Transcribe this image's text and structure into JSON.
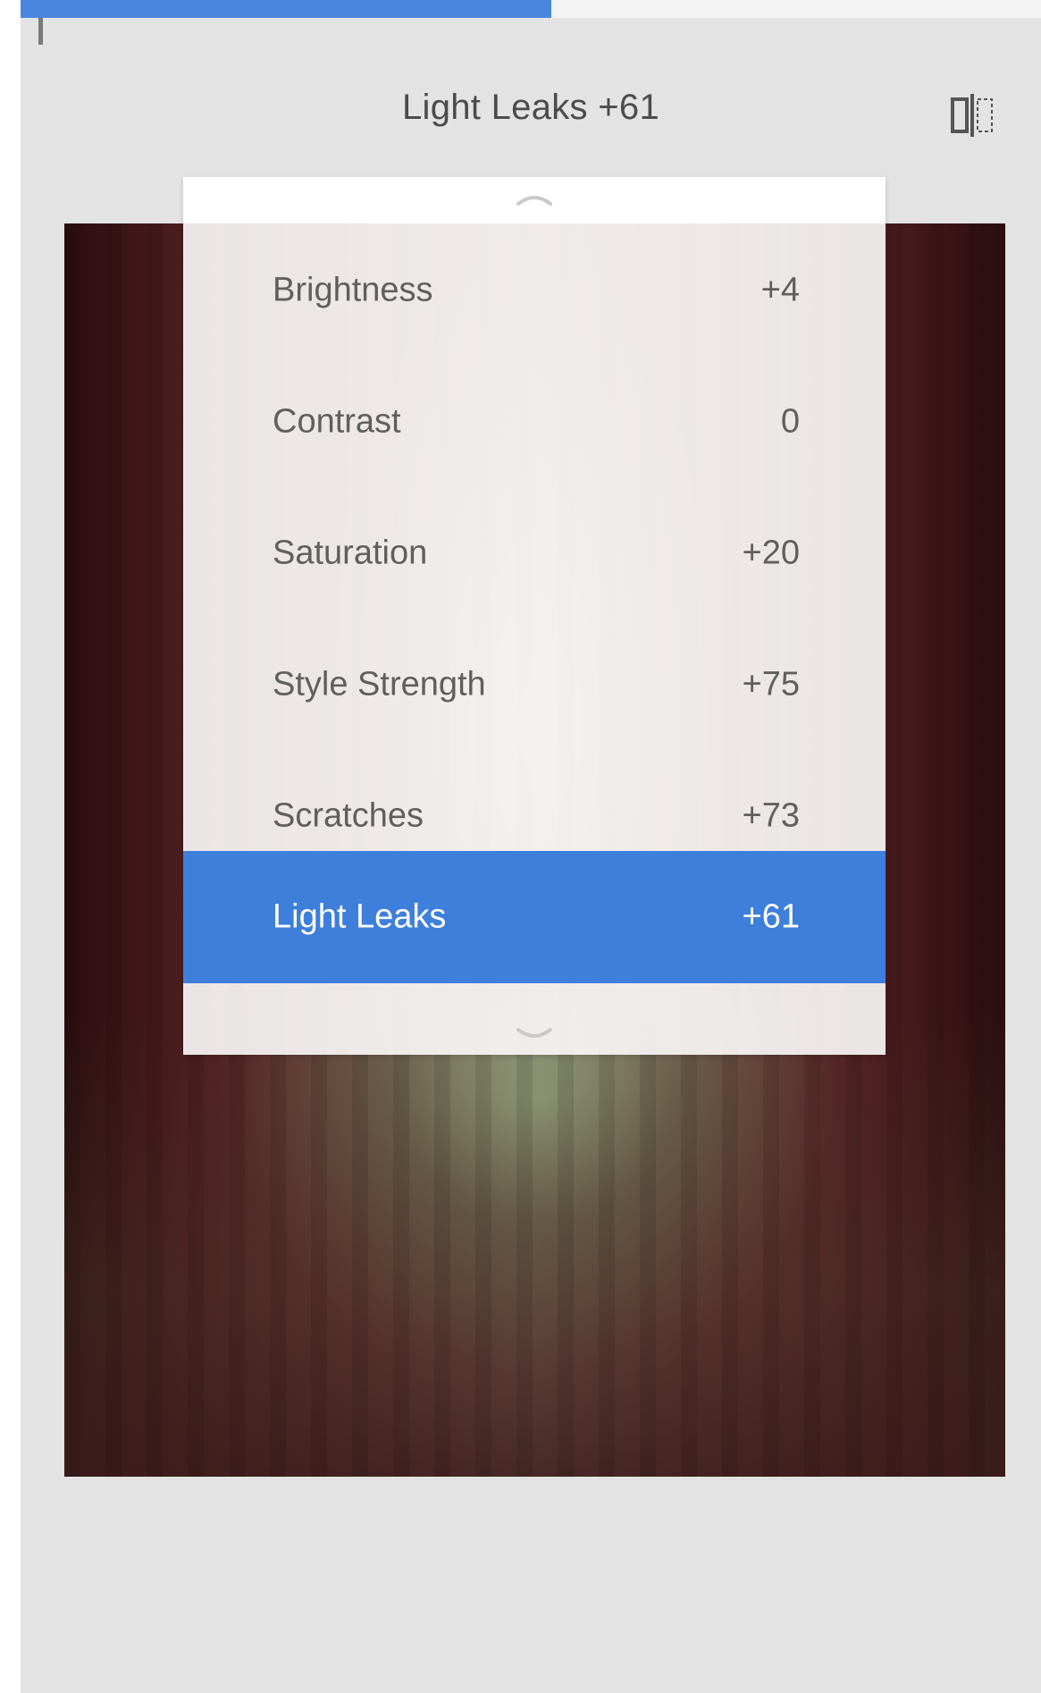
{
  "header": {
    "title": "Light Leaks +61",
    "compare_icon": "compare-split-icon"
  },
  "progress": {
    "value": 0.52,
    "color": "#4a86e0"
  },
  "menu": {
    "scroll_up_icon": "chevron-up-icon",
    "scroll_down_icon": "chevron-down-icon",
    "items": [
      {
        "label": "Brightness",
        "value": "+4",
        "selected": false
      },
      {
        "label": "Contrast",
        "value": "0",
        "selected": false
      },
      {
        "label": "Saturation",
        "value": "+20",
        "selected": false
      },
      {
        "label": "Style Strength",
        "value": "+75",
        "selected": false
      },
      {
        "label": "Scratches",
        "value": "+73",
        "selected": false
      },
      {
        "label": "Light Leaks",
        "value": "+61",
        "selected": true
      }
    ],
    "selected_color": "#3f7fdc"
  }
}
